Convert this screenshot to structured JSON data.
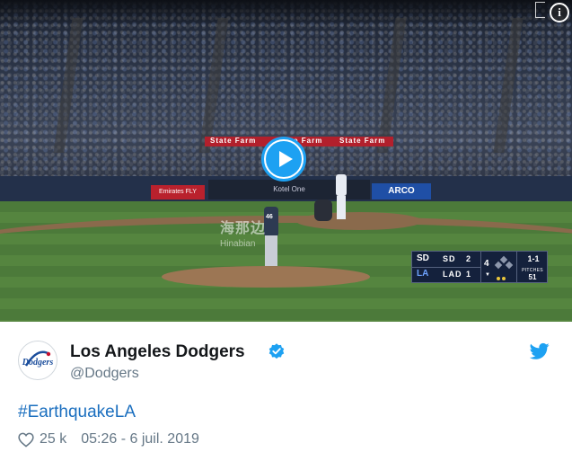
{
  "video": {
    "ads": {
      "top_sign": "State Farm",
      "left": "Emirates FLY BETTER",
      "middle": "Kotel One",
      "right": "ARCO"
    },
    "pitcher_number": "46",
    "watermark": {
      "cn": "海那边",
      "en": "Hinabian"
    },
    "play_icon": "play-icon",
    "info_icon": "info-icon",
    "scorebug": {
      "away_team": "SD",
      "away_score": "2",
      "home_team": "LAD",
      "home_score": "1",
      "inning": "4",
      "inning_half": "▼",
      "count": "1-1",
      "pitches_label": "PITCHES",
      "pitches": "51",
      "away_logo": "SD",
      "home_logo": "LA"
    }
  },
  "tweet": {
    "display_name": "Los Angeles Dodgers",
    "handle": "@Dodgers",
    "verified_icon": "verified-badge-icon",
    "avatar_text": "Dodgers",
    "text": "#EarthquakeLA",
    "likes": "25 k",
    "timestamp": "05:26 - 6 juil. 2019",
    "brand_icon": "twitter-bird-icon",
    "colors": {
      "accent": "#1da1f2",
      "link": "#1b6fbf",
      "muted": "#657786",
      "dodger_blue": "#1b4d9c"
    }
  }
}
